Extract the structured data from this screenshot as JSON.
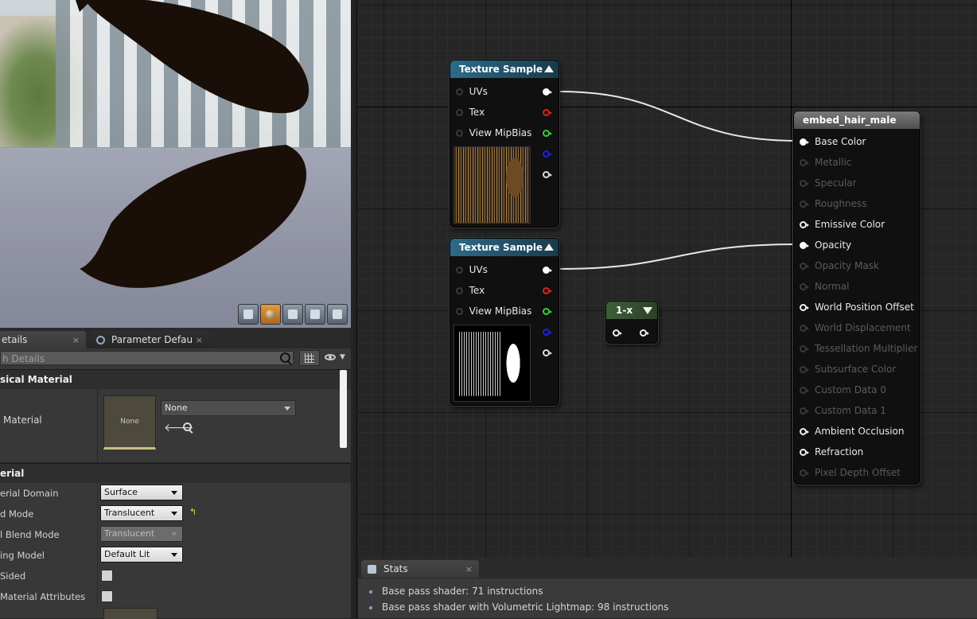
{
  "details": {
    "tabs": [
      {
        "label": "etails",
        "close": "×"
      },
      {
        "label": "Parameter Defaults",
        "close": "×"
      }
    ],
    "search_placeholder": "h Details",
    "physical_material": {
      "section_title": "sical Material",
      "row_label": "Material",
      "thumb_text": "None",
      "combo_value": "None"
    },
    "material": {
      "section_title": "erial",
      "props": [
        {
          "label": "erial Domain",
          "value": "Surface"
        },
        {
          "label": "d Mode",
          "value": "Translucent"
        },
        {
          "label": "l Blend Mode",
          "value": "Translucent"
        },
        {
          "label": "ing Model",
          "value": "Default Lit"
        },
        {
          "label": "Sided",
          "value": ""
        },
        {
          "label": "Material Attributes",
          "value": ""
        }
      ],
      "reset_glyph": "↰"
    }
  },
  "graph": {
    "texture_nodes": [
      {
        "title": "Texture Sample",
        "pins": [
          "UVs",
          "Tex",
          "View MipBias"
        ],
        "out_colors": [
          "#ffffff",
          "#e02020",
          "#2fd02f",
          "#2020e0",
          "#dddddd"
        ]
      },
      {
        "title": "Texture Sample",
        "pins": [
          "UVs",
          "Tex",
          "View MipBias"
        ],
        "out_colors": [
          "#ffffff",
          "#e02020",
          "#2fd02f",
          "#2020e0",
          "#dddddd"
        ]
      }
    ],
    "oneminus_node": {
      "title": "1-x"
    },
    "result_node": {
      "title": "embed_hair_male",
      "pins": [
        {
          "label": "Base Color",
          "state": "connected"
        },
        {
          "label": "Metallic",
          "state": "disabled"
        },
        {
          "label": "Specular",
          "state": "disabled"
        },
        {
          "label": "Roughness",
          "state": "disabled"
        },
        {
          "label": "Emissive Color",
          "state": "enabled"
        },
        {
          "label": "Opacity",
          "state": "connected"
        },
        {
          "label": "Opacity Mask",
          "state": "disabled"
        },
        {
          "label": "Normal",
          "state": "disabled"
        },
        {
          "label": "World Position Offset",
          "state": "enabled"
        },
        {
          "label": "World Displacement",
          "state": "disabled"
        },
        {
          "label": "Tessellation Multiplier",
          "state": "disabled"
        },
        {
          "label": "Subsurface Color",
          "state": "disabled"
        },
        {
          "label": "Custom Data 0",
          "state": "disabled"
        },
        {
          "label": "Custom Data 1",
          "state": "disabled"
        },
        {
          "label": "Ambient Occlusion",
          "state": "enabled"
        },
        {
          "label": "Refraction",
          "state": "enabled"
        },
        {
          "label": "Pixel Depth Offset",
          "state": "disabled"
        }
      ]
    }
  },
  "stats": {
    "tab_label": "Stats",
    "tab_close": "×",
    "lines": [
      "Base pass shader: 71 instructions",
      "Base pass shader with Volumetric Lightmap: 98 instructions"
    ]
  },
  "colors": {
    "texture_header": "#2d6b88",
    "oneminus_header": "#3e5e3a",
    "result_header": "#6a6a6a",
    "wire": "#e8e8e8"
  }
}
